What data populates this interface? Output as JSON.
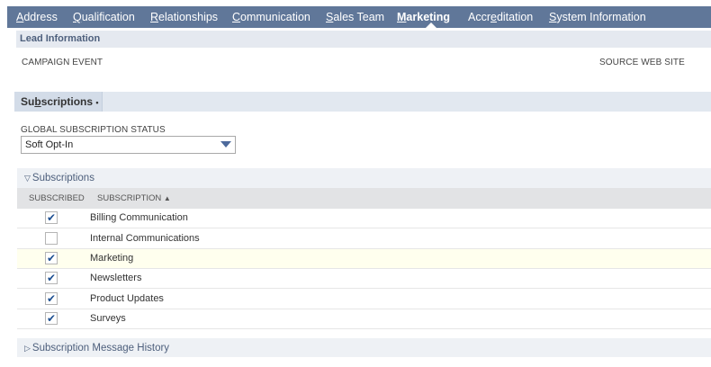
{
  "tabs": [
    {
      "pre": "",
      "u": "A",
      "post": "ddress",
      "active": false
    },
    {
      "pre": "",
      "u": "Q",
      "post": "ualification",
      "active": false
    },
    {
      "pre": "",
      "u": "R",
      "post": "elationships",
      "active": false
    },
    {
      "pre": "",
      "u": "C",
      "post": "ommunication",
      "active": false
    },
    {
      "pre": "",
      "u": "S",
      "post": "ales Team",
      "active": false
    },
    {
      "pre": "",
      "u": "M",
      "post": "arketing",
      "active": true
    },
    {
      "pre": "Accr",
      "u": "e",
      "post": "ditation",
      "active": false
    },
    {
      "pre": "",
      "u": "S",
      "post": "ystem Information",
      "active": false
    }
  ],
  "lead_info": {
    "title": "Lead Information",
    "campaign_event_label": "CAMPAIGN EVENT",
    "source_web_site_label": "SOURCE WEB SITE"
  },
  "subtab": {
    "pre": "Su",
    "u": "b",
    "post": "scriptions",
    "marker": "•"
  },
  "global_status": {
    "label": "GLOBAL SUBSCRIPTION STATUS",
    "value": "Soft Opt-In"
  },
  "subscriptions_machine": {
    "title": "Subscriptions",
    "col_subscribed": "SUBSCRIBED",
    "col_subscription": "SUBSCRIPTION",
    "rows": [
      {
        "name": "Billing Communication",
        "checked": true,
        "mark": "✔"
      },
      {
        "name": "Internal Communications",
        "checked": false,
        "mark": ""
      },
      {
        "name": "Marketing",
        "checked": true,
        "mark": "✔"
      },
      {
        "name": "Newsletters",
        "checked": true,
        "mark": "✔"
      },
      {
        "name": "Product Updates",
        "checked": true,
        "mark": "✔"
      },
      {
        "name": "Surveys",
        "checked": true,
        "mark": "✔"
      }
    ]
  },
  "history": {
    "title": "Subscription Message History"
  },
  "colors": {
    "tabbar": "#607799",
    "band": "#e5e9f0",
    "highlight_row": "#ffffee",
    "check": "#1d4f91"
  }
}
